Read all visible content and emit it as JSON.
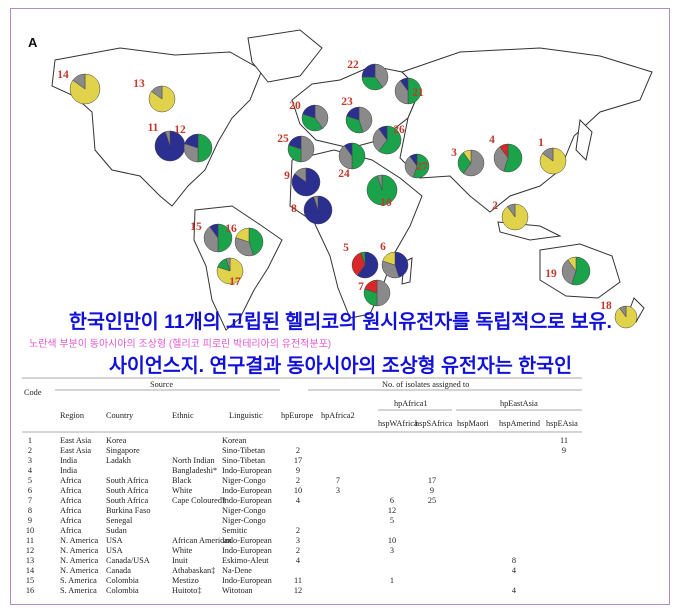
{
  "panel_label": "A",
  "headline1": "한국인만이 11개의 고립된 헬리코의 원시유전자를 독립적으로 보유.",
  "note": "노란색 부분이 동아시아의 조상형 (헬리코 피로린 박테리아의 유전적분포)",
  "headline2": "사이언스지. 연구결과 동아시아의 조상형 유전자는 한국인",
  "colors": {
    "navy": "#2b2f8f",
    "green": "#1aa34a",
    "gray": "#8a8a8a",
    "yellow": "#e0d24a",
    "red": "#d62828",
    "land": "#ffffff",
    "coast": "#333333"
  },
  "pies": [
    {
      "label": "1",
      "slices": [
        [
          "yellow",
          0.85
        ],
        [
          "gray",
          0.15
        ]
      ]
    },
    {
      "label": "2",
      "slices": [
        [
          "yellow",
          0.9
        ],
        [
          "gray",
          0.1
        ]
      ]
    },
    {
      "label": "3",
      "slices": [
        [
          "gray",
          0.6
        ],
        [
          "green",
          0.3
        ],
        [
          "yellow",
          0.1
        ]
      ]
    },
    {
      "label": "4",
      "slices": [
        [
          "green",
          0.55
        ],
        [
          "gray",
          0.35
        ],
        [
          "red",
          0.1
        ]
      ]
    },
    {
      "label": "5",
      "slices": [
        [
          "navy",
          0.6
        ],
        [
          "red",
          0.35
        ],
        [
          "green",
          0.05
        ]
      ]
    },
    {
      "label": "6",
      "slices": [
        [
          "navy",
          0.45
        ],
        [
          "gray",
          0.35
        ],
        [
          "yellow",
          0.2
        ]
      ]
    },
    {
      "label": "7",
      "slices": [
        [
          "gray",
          0.5
        ],
        [
          "green",
          0.3
        ],
        [
          "red",
          0.2
        ]
      ]
    },
    {
      "label": "8",
      "slices": [
        [
          "navy",
          0.95
        ],
        [
          "gray",
          0.05
        ]
      ]
    },
    {
      "label": "9",
      "slices": [
        [
          "navy",
          0.85
        ],
        [
          "gray",
          0.15
        ]
      ]
    },
    {
      "label": "10",
      "slices": [
        [
          "green",
          0.95
        ],
        [
          "gray",
          0.05
        ]
      ]
    },
    {
      "label": "11",
      "slices": [
        [
          "navy",
          0.95
        ],
        [
          "gray",
          0.05
        ]
      ]
    },
    {
      "label": "12",
      "slices": [
        [
          "green",
          0.5
        ],
        [
          "gray",
          0.3
        ],
        [
          "navy",
          0.2
        ]
      ]
    },
    {
      "label": "13",
      "slices": [
        [
          "yellow",
          0.85
        ],
        [
          "gray",
          0.15
        ]
      ]
    },
    {
      "label": "14",
      "slices": [
        [
          "yellow",
          0.85
        ],
        [
          "gray",
          0.15
        ]
      ]
    },
    {
      "label": "15",
      "slices": [
        [
          "green",
          0.5
        ],
        [
          "gray",
          0.4
        ],
        [
          "navy",
          0.1
        ]
      ]
    },
    {
      "label": "16",
      "slices": [
        [
          "green",
          0.45
        ],
        [
          "gray",
          0.35
        ],
        [
          "yellow",
          0.2
        ]
      ]
    },
    {
      "label": "17",
      "slices": [
        [
          "yellow",
          0.8
        ],
        [
          "green",
          0.15
        ],
        [
          "gray",
          0.05
        ]
      ]
    },
    {
      "label": "18",
      "slices": [
        [
          "yellow",
          0.9
        ],
        [
          "gray",
          0.1
        ]
      ]
    },
    {
      "label": "19",
      "slices": [
        [
          "green",
          0.55
        ],
        [
          "gray",
          0.35
        ],
        [
          "yellow",
          0.1
        ]
      ]
    },
    {
      "label": "20",
      "slices": [
        [
          "gray",
          0.4
        ],
        [
          "green",
          0.4
        ],
        [
          "navy",
          0.2
        ]
      ]
    },
    {
      "label": "21",
      "slices": [
        [
          "green",
          0.5
        ],
        [
          "gray",
          0.4
        ],
        [
          "navy",
          0.1
        ]
      ]
    },
    {
      "label": "22",
      "slices": [
        [
          "gray",
          0.4
        ],
        [
          "green",
          0.35
        ],
        [
          "navy",
          0.25
        ]
      ]
    },
    {
      "label": "23",
      "slices": [
        [
          "gray",
          0.45
        ],
        [
          "green",
          0.35
        ],
        [
          "navy",
          0.2
        ]
      ]
    },
    {
      "label": "24",
      "slices": [
        [
          "green",
          0.5
        ],
        [
          "gray",
          0.4
        ],
        [
          "navy",
          0.1
        ]
      ]
    },
    {
      "label": "25",
      "slices": [
        [
          "gray",
          0.5
        ],
        [
          "green",
          0.3
        ],
        [
          "navy",
          0.2
        ]
      ]
    },
    {
      "label": "26",
      "slices": [
        [
          "green",
          0.6
        ],
        [
          "gray",
          0.3
        ],
        [
          "navy",
          0.1
        ]
      ]
    },
    {
      "label": "27",
      "slices": [
        [
          "green",
          0.55
        ],
        [
          "gray",
          0.35
        ],
        [
          "navy",
          0.1
        ]
      ]
    }
  ],
  "table": {
    "headers": {
      "code": "Code",
      "source": "Source",
      "isolates": "No. of isolates assigned to",
      "region": "Region",
      "country": "Country",
      "ethnic": "Ethnic",
      "linguistic": "Linguistic",
      "hpEurope": "hpEurope",
      "hpAfrica2": "hpAfrica2",
      "hpAfrica1": "hpAfrica1",
      "hspWAfrica": "hspWAfrica",
      "hspSAfrica": "hspSAfrica",
      "hpEastAsia": "hpEastAsia",
      "hspMaori": "hspMaori",
      "hspAmerind": "hspAmerind",
      "hspEAsia": "hspEAsia"
    },
    "rows": [
      [
        "1",
        "East Asia",
        "Korea",
        "",
        "Korean",
        "",
        "",
        "",
        "",
        "",
        "",
        "11"
      ],
      [
        "2",
        "East Asia",
        "Singapore",
        "",
        "Sino-Tibetan",
        "2",
        "",
        "",
        "",
        "",
        "",
        "9"
      ],
      [
        "3",
        "India",
        "Ladakh",
        "North Indian",
        "Sino-Tibetan",
        "17",
        "",
        "",
        "",
        "",
        "",
        ""
      ],
      [
        "4",
        "India",
        "",
        "Bangladeshi*",
        "Indo-European",
        "9",
        "",
        "",
        "",
        "",
        "",
        ""
      ],
      [
        "5",
        "Africa",
        "South Africa",
        "Black",
        "Niger-Congo",
        "2",
        "7",
        "",
        "17",
        "",
        "",
        ""
      ],
      [
        "6",
        "Africa",
        "South Africa",
        "White",
        "Indo-European",
        "10",
        "3",
        "",
        "9",
        "",
        "",
        ""
      ],
      [
        "7",
        "Africa",
        "South Africa",
        "Cape Coloured†",
        "Indo-European",
        "4",
        "",
        "6",
        "25",
        "",
        "",
        ""
      ],
      [
        "8",
        "Africa",
        "Burkina Faso",
        "",
        "Niger-Congo",
        "",
        "",
        "12",
        "",
        "",
        "",
        ""
      ],
      [
        "9",
        "Africa",
        "Senegal",
        "",
        "Niger-Congo",
        "",
        "",
        "5",
        "",
        "",
        "",
        ""
      ],
      [
        "10",
        "Africa",
        "Sudan",
        "",
        "Semitic",
        "2",
        "",
        "",
        "",
        "",
        "",
        ""
      ],
      [
        "11",
        "N. America",
        "USA",
        "African American",
        "Indo-European",
        "3",
        "",
        "10",
        "",
        "",
        "",
        ""
      ],
      [
        "12",
        "N. America",
        "USA",
        "White",
        "Indo-European",
        "2",
        "",
        "3",
        "",
        "",
        "",
        ""
      ],
      [
        "13",
        "N. America",
        "Canada/USA",
        "Inuit",
        "Eskimo-Aleut",
        "4",
        "",
        "",
        "",
        "",
        "8",
        ""
      ],
      [
        "14",
        "N. America",
        "Canada",
        "Athabaskan‡",
        "Na-Dene",
        "",
        "",
        "",
        "",
        "",
        "4",
        ""
      ],
      [
        "15",
        "S. America",
        "Colombia",
        "Mestizo",
        "Indo-European",
        "11",
        "",
        "1",
        "",
        "",
        "",
        ""
      ],
      [
        "16",
        "S. America",
        "Colombia",
        "Huitoto‡",
        "Witotoan",
        "12",
        "",
        "",
        "",
        "",
        "4",
        ""
      ]
    ]
  }
}
